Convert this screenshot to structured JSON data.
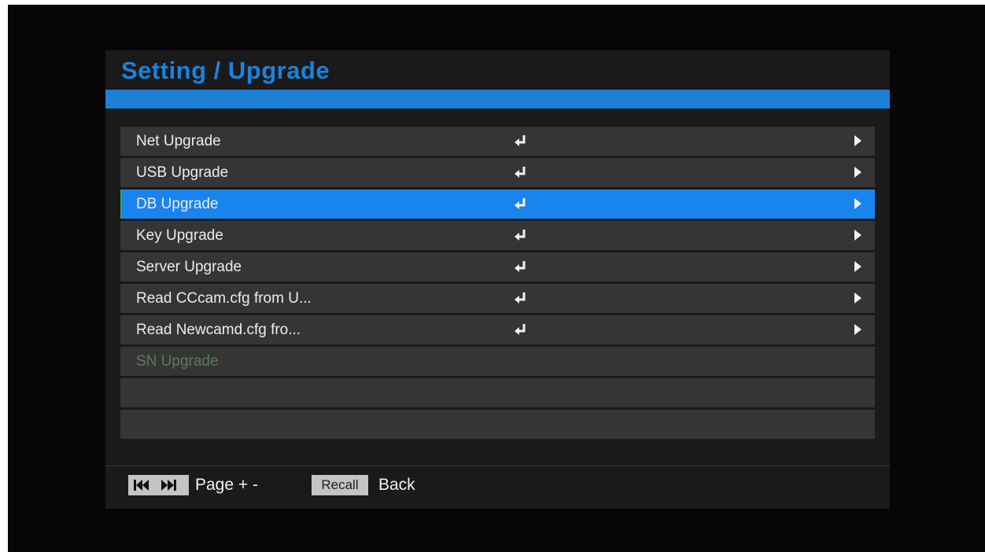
{
  "header": {
    "title": "Setting / Upgrade"
  },
  "menu": {
    "items": [
      {
        "label": "Net Upgrade",
        "state": "normal",
        "has_enter": true,
        "has_arrow": true
      },
      {
        "label": "USB Upgrade",
        "state": "normal",
        "has_enter": true,
        "has_arrow": true
      },
      {
        "label": "DB Upgrade",
        "state": "selected",
        "has_enter": true,
        "has_arrow": true
      },
      {
        "label": "Key Upgrade",
        "state": "normal",
        "has_enter": true,
        "has_arrow": true
      },
      {
        "label": "Server Upgrade",
        "state": "normal",
        "has_enter": true,
        "has_arrow": true
      },
      {
        "label": "Read CCcam.cfg from U...",
        "state": "normal",
        "has_enter": true,
        "has_arrow": true
      },
      {
        "label": "Read Newcamd.cfg fro...",
        "state": "normal",
        "has_enter": true,
        "has_arrow": true
      },
      {
        "label": "SN Upgrade",
        "state": "disabled",
        "has_enter": false,
        "has_arrow": false
      },
      {
        "label": "",
        "state": "empty",
        "has_enter": false,
        "has_arrow": false
      },
      {
        "label": "",
        "state": "empty",
        "has_enter": false,
        "has_arrow": false
      }
    ],
    "icons": {
      "enter": "enter-return-icon",
      "arrow": "arrow-right-icon"
    }
  },
  "footer": {
    "skip_icon": "skip-prev-next-icon",
    "page_label": "Page + -",
    "recall_key": "Recall",
    "back_label": "Back"
  },
  "colors": {
    "accent": "#1b82dc",
    "selected_row": "#1a84ee",
    "row": "#353535",
    "panel": "#1a1a1a",
    "background": "#060606",
    "disabled_text": "#5f7a5f"
  }
}
